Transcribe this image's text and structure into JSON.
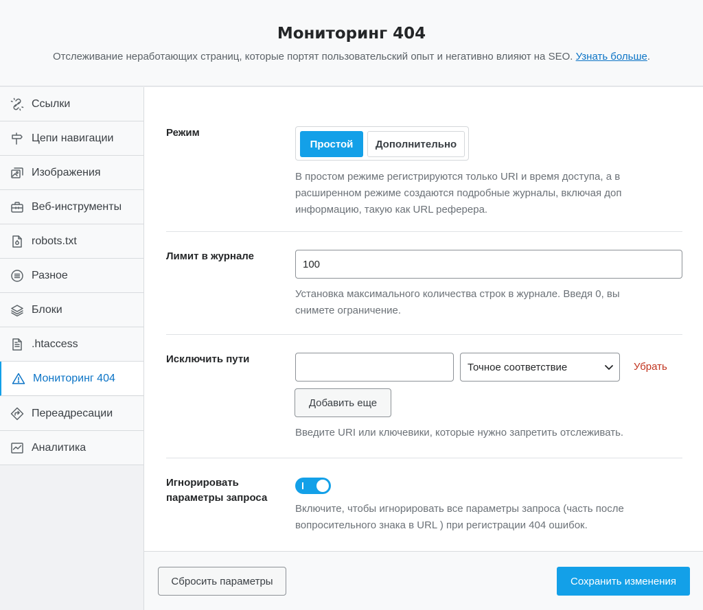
{
  "header": {
    "title": "Мониторинг 404",
    "description": "Отслеживание неработающих страниц, которые портят пользовательский опыт и негативно влияют на SEO.",
    "learn_more": "Узнать больше"
  },
  "sidebar": {
    "items": [
      {
        "label": "Ссылки",
        "icon": "link-broken-icon"
      },
      {
        "label": "Цепи навигации",
        "icon": "signpost-icon"
      },
      {
        "label": "Изображения",
        "icon": "images-icon"
      },
      {
        "label": "Веб-инструменты",
        "icon": "toolbox-icon"
      },
      {
        "label": "robots.txt",
        "icon": "file-robot-icon"
      },
      {
        "label": "Разное",
        "icon": "list-circle-icon"
      },
      {
        "label": "Блоки",
        "icon": "blocks-icon"
      },
      {
        "label": ".htaccess",
        "icon": "file-text-icon"
      },
      {
        "label": "Мониторинг 404",
        "icon": "warning-icon",
        "active": true
      },
      {
        "label": "Переадресации",
        "icon": "redirect-icon"
      },
      {
        "label": "Аналитика",
        "icon": "analytics-icon"
      }
    ]
  },
  "settings": {
    "mode": {
      "label": "Режим",
      "options": [
        "Простой",
        "Дополнительно"
      ],
      "selected": "Простой",
      "help": "В простом режиме регистрируются только URI и время доступа, а в расширенном режиме создаются подробные журналы, включая доп информацию, такую как URL реферера."
    },
    "log_limit": {
      "label": "Лимит в журнале",
      "value": "100",
      "help": "Установка максимального количества строк в журнале. Введя 0, вы снимете ограничение."
    },
    "exclude_paths": {
      "label": "Исключить пути",
      "path_value": "",
      "match_type": "Точное соответствие",
      "remove_label": "Убрать",
      "add_more_label": "Добавить еще",
      "help": "Введите URI или ключевики, которые нужно запретить отслеживать."
    },
    "ignore_query": {
      "label": "Игнорировать параметры запроса",
      "enabled": true,
      "help": "Включите, чтобы игнорировать все параметры запроса (часть после вопросительного знака в URL ) при регистрации 404 ошибок."
    }
  },
  "footer": {
    "reset_label": "Сбросить параметры",
    "save_label": "Сохранить изменения"
  },
  "colors": {
    "accent": "#13a0e8",
    "link": "#0c74c6",
    "danger": "#c1341f"
  }
}
